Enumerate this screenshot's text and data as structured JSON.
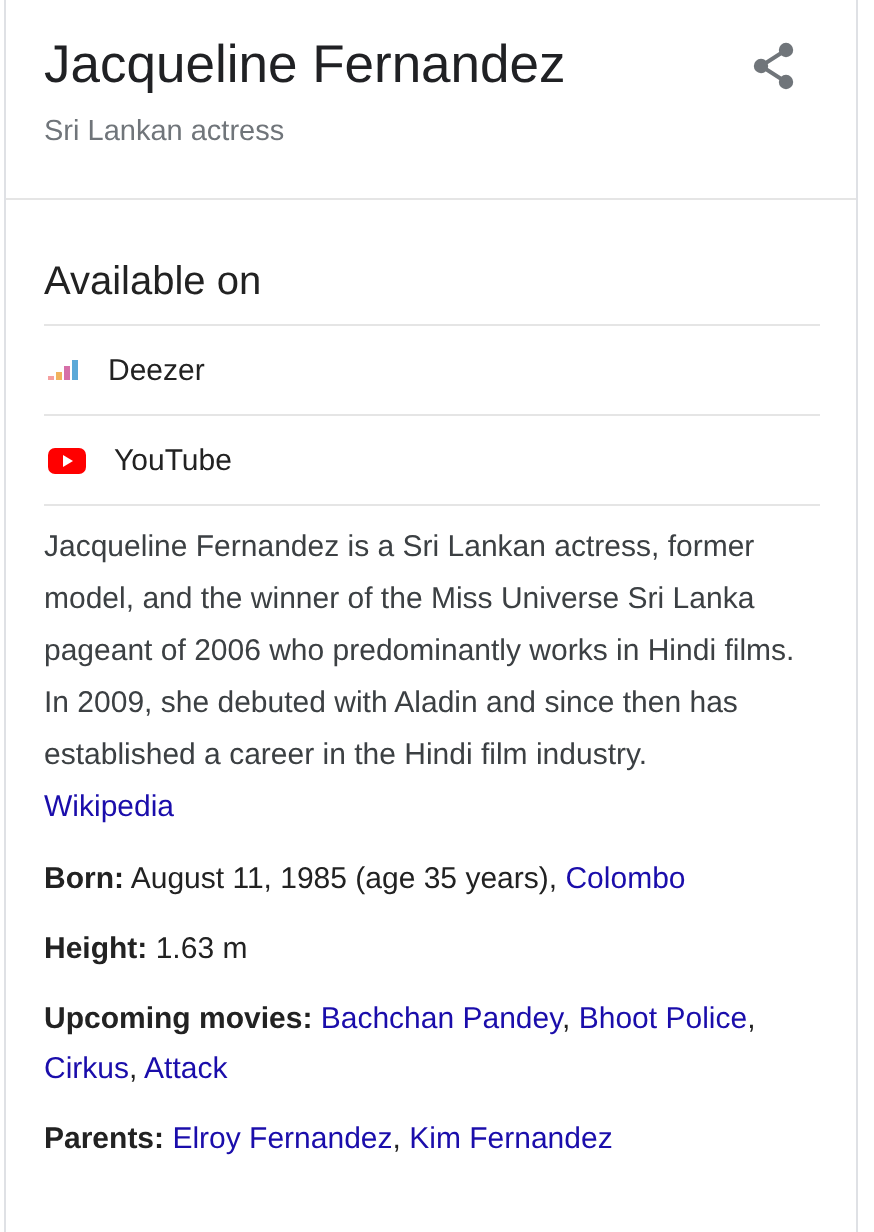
{
  "header": {
    "title": "Jacqueline Fernandez",
    "subtitle": "Sri Lankan actress"
  },
  "available_on": {
    "heading": "Available on",
    "services": [
      {
        "kind": "deezer",
        "label": "Deezer"
      },
      {
        "kind": "youtube",
        "label": "YouTube"
      }
    ]
  },
  "description": {
    "text": "Jacqueline Fernandez is a Sri Lankan actress, former model, and the winner of the Miss Universe Sri Lanka pageant of 2006 who predominantly works in Hindi films. In 2009, she debuted with Aladin and since then has established a career in the Hindi film industry.",
    "source_link": "Wikipedia"
  },
  "facts": [
    {
      "label": "Born:",
      "parts": [
        {
          "kind": "plain",
          "text": "August 11, 1985 (age 35 years), "
        },
        {
          "kind": "link",
          "text": "Colombo"
        }
      ]
    },
    {
      "label": "Height:",
      "parts": [
        {
          "kind": "plain",
          "text": "1.63 m"
        }
      ]
    },
    {
      "label": "Upcoming movies:",
      "parts": [
        {
          "kind": "link",
          "text": "Bachchan Pandey"
        },
        {
          "kind": "plain",
          "text": ", "
        },
        {
          "kind": "link",
          "text": "Bhoot Police"
        },
        {
          "kind": "plain",
          "text": ", "
        },
        {
          "kind": "link",
          "text": "Cirkus"
        },
        {
          "kind": "plain",
          "text": ", "
        },
        {
          "kind": "link",
          "text": "Attack"
        }
      ]
    },
    {
      "label": "Parents:",
      "parts": [
        {
          "kind": "link",
          "text": "Elroy Fernandez"
        },
        {
          "kind": "plain",
          "text": ", "
        },
        {
          "kind": "link",
          "text": "Kim Fernandez"
        }
      ]
    }
  ]
}
